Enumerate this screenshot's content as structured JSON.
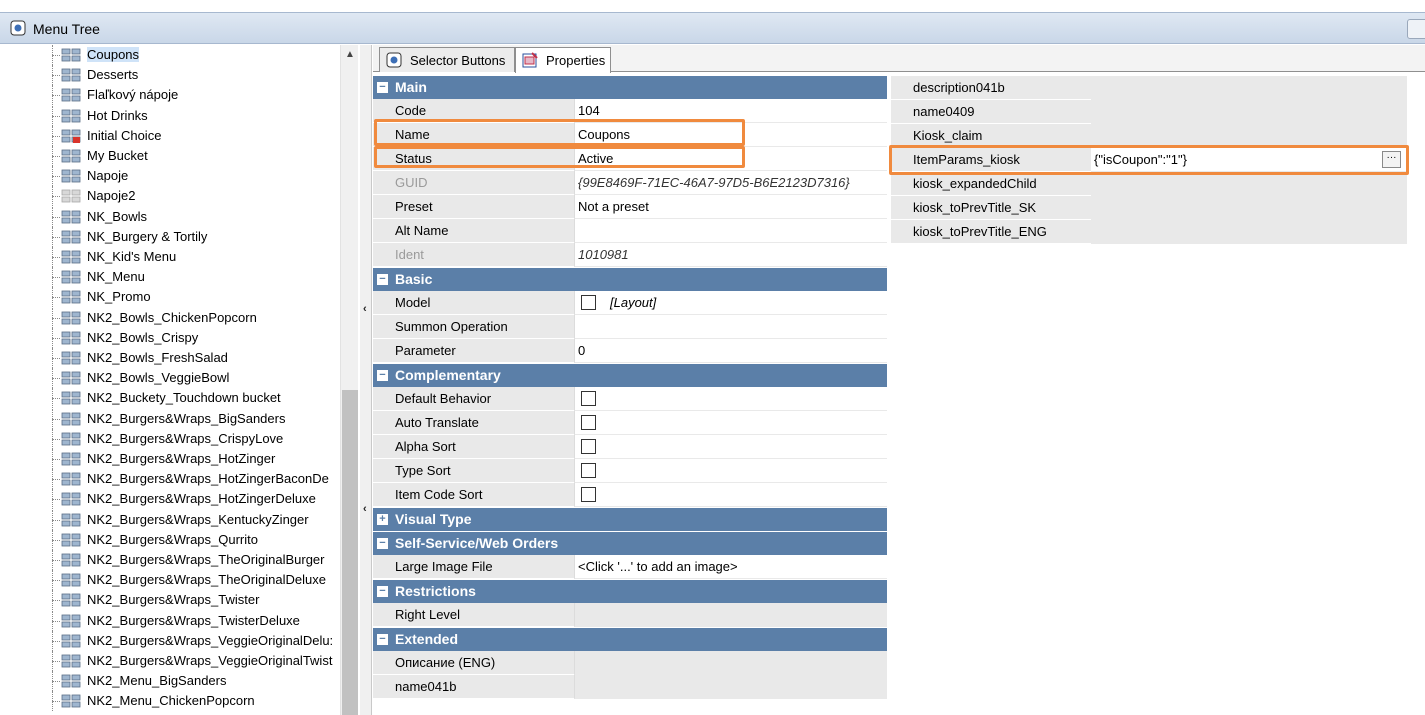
{
  "window": {
    "title": "Menu Tree"
  },
  "tree": {
    "items": [
      {
        "label": "Coupons",
        "selected": true
      },
      {
        "label": "Desserts"
      },
      {
        "label": "Flaľkový nápoje"
      },
      {
        "label": "Hot Drinks"
      },
      {
        "label": "Initial Choice",
        "icon": "menu-node-special-icon"
      },
      {
        "label": "My Bucket"
      },
      {
        "label": "Napoje"
      },
      {
        "label": "Napoje2",
        "icon": "menu-node-disabled-icon"
      },
      {
        "label": "NK_Bowls"
      },
      {
        "label": "NK_Burgery & Tortily"
      },
      {
        "label": "NK_Kid's Menu"
      },
      {
        "label": "NK_Menu"
      },
      {
        "label": "NK_Promo"
      },
      {
        "label": "NK2_Bowls_ChickenPopcorn"
      },
      {
        "label": "NK2_Bowls_Crispy"
      },
      {
        "label": "NK2_Bowls_FreshSalad"
      },
      {
        "label": "NK2_Bowls_VeggieBowl"
      },
      {
        "label": "NK2_Buckety_Touchdown bucket"
      },
      {
        "label": "NK2_Burgers&Wraps_BigSanders"
      },
      {
        "label": "NK2_Burgers&Wraps_CrispyLove"
      },
      {
        "label": "NK2_Burgers&Wraps_HotZinger"
      },
      {
        "label": "NK2_Burgers&Wraps_HotZingerBaconDe"
      },
      {
        "label": "NK2_Burgers&Wraps_HotZingerDeluxe"
      },
      {
        "label": "NK2_Burgers&Wraps_KentuckyZinger"
      },
      {
        "label": "NK2_Burgers&Wraps_Qurrito"
      },
      {
        "label": "NK2_Burgers&Wraps_TheOriginalBurger"
      },
      {
        "label": "NK2_Burgers&Wraps_TheOriginalDeluxe"
      },
      {
        "label": "NK2_Burgers&Wraps_Twister"
      },
      {
        "label": "NK2_Burgers&Wraps_TwisterDeluxe"
      },
      {
        "label": "NK2_Burgers&Wraps_VeggieOriginalDelu:"
      },
      {
        "label": "NK2_Burgers&Wraps_VeggieOriginalTwist"
      },
      {
        "label": "NK2_Menu_BigSanders"
      },
      {
        "label": "NK2_Menu_ChickenPopcorn"
      }
    ]
  },
  "tabs": [
    {
      "label": "Selector Buttons",
      "icon": "selector-icon"
    },
    {
      "label": "Properties",
      "icon": "properties-icon",
      "active": true
    }
  ],
  "properties": {
    "main": {
      "label": "Main",
      "code": {
        "name": "Code",
        "value": "104"
      },
      "name": {
        "name": "Name",
        "value": "Coupons"
      },
      "status": {
        "name": "Status",
        "value": "Active"
      },
      "guid": {
        "name": "GUID",
        "value": "{99E8469F-71EC-46A7-97D5-B6E2123D7316}"
      },
      "preset": {
        "name": "Preset",
        "value": "Not a preset"
      },
      "alt_name": {
        "name": "Alt Name",
        "value": ""
      },
      "ident": {
        "name": "Ident",
        "value": "1010981"
      }
    },
    "basic": {
      "label": "Basic",
      "model": {
        "name": "Model",
        "value": "[Layout]",
        "checked": false
      },
      "summon": {
        "name": "Summon Operation",
        "value": ""
      },
      "parameter": {
        "name": "Parameter",
        "value": "0"
      }
    },
    "complementary": {
      "label": "Complementary",
      "default_behavior": {
        "name": "Default Behavior",
        "checked": false
      },
      "auto_translate": {
        "name": "Auto Translate",
        "checked": false
      },
      "alpha_sort": {
        "name": "Alpha Sort",
        "checked": false
      },
      "type_sort": {
        "name": "Type Sort",
        "checked": false
      },
      "item_code_sort": {
        "name": "Item Code Sort",
        "checked": false
      }
    },
    "visual_type": {
      "label": "Visual Type"
    },
    "self_service": {
      "label": "Self-Service/Web Orders",
      "large_image": {
        "name": "Large Image File",
        "value": "<Click '...' to add an image>"
      }
    },
    "restrictions": {
      "label": "Restrictions",
      "right_level": {
        "name": "Right Level",
        "value": ""
      }
    },
    "extended": {
      "label": "Extended",
      "opisanie": {
        "name": "Описание (ENG)",
        "value": ""
      },
      "name041b": {
        "name": "name041b",
        "value": ""
      }
    }
  },
  "extended_right": {
    "rows": [
      {
        "name": "description041b",
        "value": ""
      },
      {
        "name": "name0409",
        "value": ""
      },
      {
        "name": "Kiosk_claim",
        "value": ""
      },
      {
        "name": "ItemParams_kiosk",
        "value": "{\"isCoupon\":\"1\"}"
      },
      {
        "name": "kiosk_expandedChild",
        "value": ""
      },
      {
        "name": "kiosk_toPrevTitle_SK",
        "value": ""
      },
      {
        "name": "kiosk_toPrevTitle_ENG",
        "value": ""
      }
    ],
    "ellipsis_label": "···"
  },
  "colors": {
    "category_bg": "#5b7fa8",
    "highlight": "#f08a3e",
    "row_name_bg": "#e9e9e9"
  }
}
